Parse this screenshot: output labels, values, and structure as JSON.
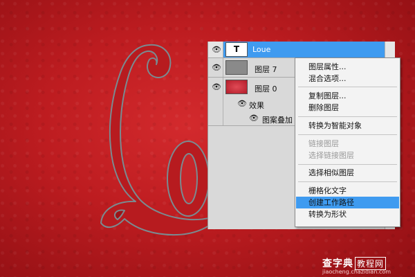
{
  "layers": [
    {
      "name": "Loue",
      "thumb": "T",
      "selected": true
    },
    {
      "name": "图层 7"
    },
    {
      "name": "图层 0"
    },
    {
      "name": "效果"
    },
    {
      "name": "图案叠加"
    }
  ],
  "context_menu": {
    "items": [
      {
        "label": "图层属性...",
        "disabled": false
      },
      {
        "label": "混合选项...",
        "disabled": false
      },
      {
        "label": "复制图层...",
        "disabled": false
      },
      {
        "label": "删除图层",
        "disabled": false
      },
      {
        "label": "转换为智能对象",
        "disabled": false
      },
      {
        "label": "链接图层",
        "disabled": true
      },
      {
        "label": "选择链接图层",
        "disabled": true
      },
      {
        "label": "选择相似图层",
        "disabled": false
      },
      {
        "label": "栅格化文字",
        "disabled": false
      },
      {
        "label": "创建工作路径",
        "disabled": false,
        "highlighted": true
      },
      {
        "label": "转换为形状",
        "disabled": false
      }
    ]
  },
  "watermark": {
    "line1_main": "查字典",
    "line1_box": "教程网",
    "line2": "jiaocheng.chazidian.com"
  },
  "colors": {
    "background": "#c11f24",
    "selection": "#3f9bf0",
    "menu_highlight": "#3f9bf0"
  },
  "icons": {
    "visibility": "eye-icon",
    "text_layer": "text-layer-icon"
  }
}
